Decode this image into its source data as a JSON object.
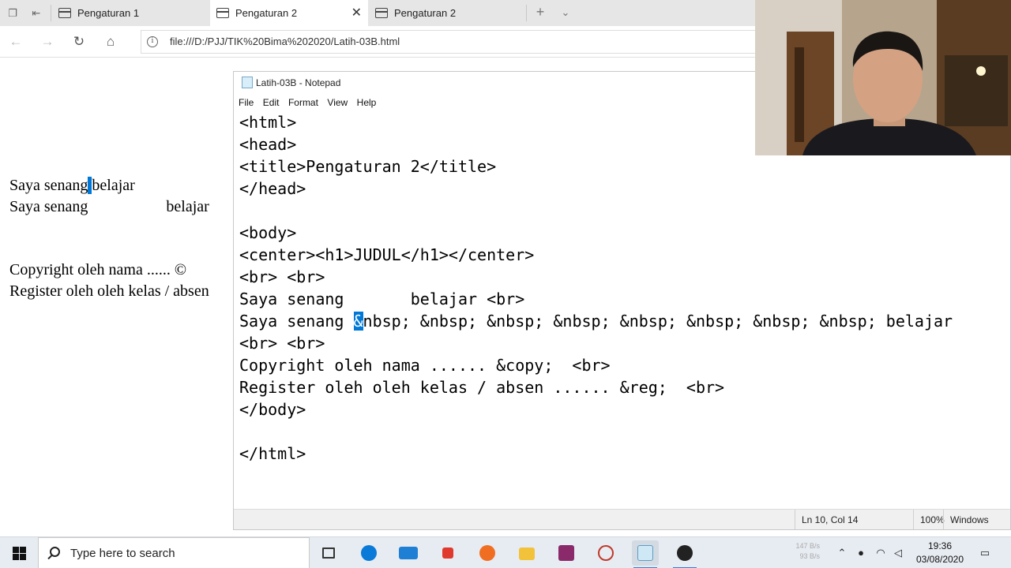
{
  "browser": {
    "tabs": [
      {
        "label": "Pengaturan 1",
        "active": false
      },
      {
        "label": "Pengaturan 2",
        "active": true
      },
      {
        "label": "Pengaturan 2",
        "active": false
      }
    ],
    "new_tab_icon": "plus-icon",
    "tab_menu_icon": "chevron-down-icon",
    "close_icon": "close-icon",
    "url": "file:///D:/PJJ/TIK%20Bima%202020/Latih-03B.html",
    "nav_icons": [
      "back-arrow-icon",
      "forward-arrow-icon",
      "refresh-icon",
      "home-icon",
      "info-icon"
    ]
  },
  "rendered_page": {
    "line1_a": "Saya senang",
    "line1_b": "belajar",
    "line2_a": "Saya senang",
    "line2_b": "belajar",
    "line3": "Copyright oleh nama ...... ©",
    "line4": "Register oleh oleh kelas / absen"
  },
  "notepad": {
    "title": "Latih-03B - Notepad",
    "menu": [
      "File",
      "Edit",
      "Format",
      "View",
      "Help"
    ],
    "lines": [
      "<html>",
      "<head>",
      "<title>Pengaturan 2</title>",
      "</head>",
      "",
      "<body>",
      "<center><h1>JUDUL</h1></center>",
      "<br> <br>",
      "Saya senang       belajar <br>",
      "Saya senang ",
      "<br> <br>",
      "Copyright oleh nama ...... &copy;  <br>",
      "Register oleh oleh kelas / absen ...... &reg;  <br>",
      "</body>",
      "",
      "</html>"
    ],
    "cursor_char": "&",
    "cursor_rest": "nbsp; &nbsp; &nbsp; &nbsp; &nbsp; &nbsp; &nbsp; &nbsp; belajar",
    "status": {
      "position": "Ln 10, Col 14",
      "zoom": "100%",
      "encoding": "Windows (CRLF)"
    }
  },
  "taskbar": {
    "search_placeholder": "Type here to search",
    "apps": [
      "task-view-icon",
      "edge-icon",
      "mail-icon",
      "gift-icon",
      "firefox-icon",
      "file-explorer-icon",
      "winrar-icon",
      "snipping-tool-icon",
      "notepad-icon",
      "obs-icon"
    ],
    "net_up": "147 B/s",
    "net_down": "93 B/s",
    "time": "19:36",
    "date": "03/08/2020",
    "tray_icons": [
      "chevron-up-icon",
      "microphone-icon",
      "wifi-icon",
      "speaker-icon",
      "notification-icon"
    ],
    "colors": {
      "accent": "#0078d7",
      "taskbar": "#e7ecf2"
    }
  }
}
